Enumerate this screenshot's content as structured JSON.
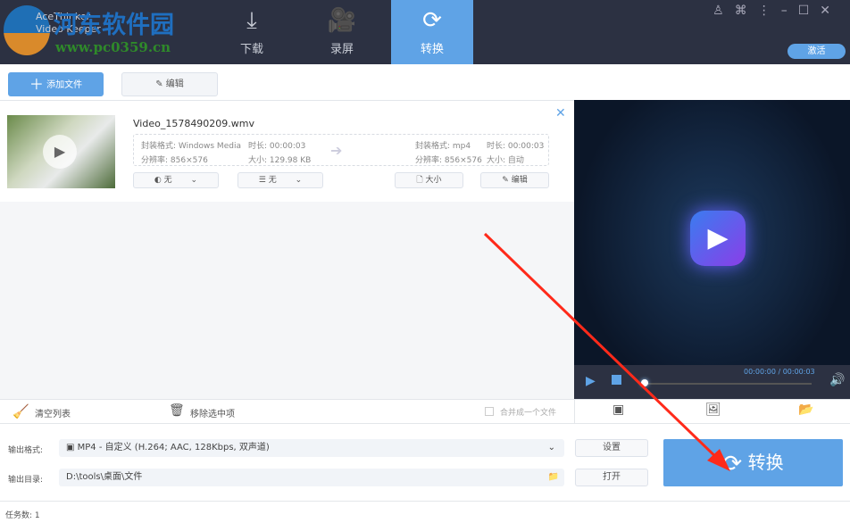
{
  "app": {
    "brand_line1": "AceThinker",
    "brand_line2": "Video Keeper",
    "activate": "激活"
  },
  "watermark": {
    "name": "河东软件园",
    "url": "www.pc0359.cn"
  },
  "tabs": [
    {
      "label": "下载",
      "icon": "download-icon"
    },
    {
      "label": "录屏",
      "icon": "camera-icon"
    },
    {
      "label": "转换",
      "icon": "convert-icon",
      "active": true
    }
  ],
  "toolbar": {
    "add_file": "添加文件",
    "edit": "编辑"
  },
  "file": {
    "name": "Video_1578490209.wmv",
    "src": {
      "format": "封装格式: Windows Media",
      "duration": "时长: 00:00:03",
      "resolution": "分辨率: 856×576",
      "size": "大小: 129.98 KB"
    },
    "dst": {
      "format": "封装格式: mp4",
      "duration": "时长: 00:00:03",
      "resolution": "分辨率: 856×576",
      "size": "大小: 自动"
    },
    "audio": "无",
    "subtitle": "无",
    "size_btn": "大小",
    "edit_btn": "编辑"
  },
  "player": {
    "time": "00:00:00 / 00:00:03",
    "progress": 0
  },
  "actions": {
    "clear": "清空列表",
    "remove": "移除选中项",
    "merge": "合并成一个文件"
  },
  "output": {
    "format_label": "输出格式:",
    "format_value": "MP4 - 自定义 (H.264; AAC, 128Kbps, 双声道)",
    "dir_label": "输出目录:",
    "dir_value": "D:\\tools\\桌面\\文件",
    "settings": "设置",
    "open": "打开"
  },
  "convert": "转换",
  "status": "任务数: 1",
  "colors": {
    "accent": "#5fa3e6",
    "header": "#2c3142",
    "arrow": "#ff2a1a"
  }
}
